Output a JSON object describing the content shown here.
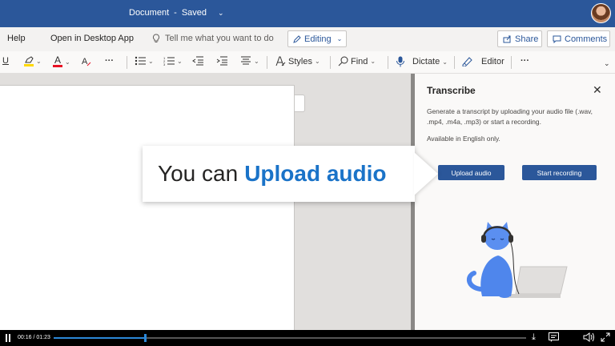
{
  "titlebar": {
    "doc_name": "Document",
    "separator": "-",
    "status": "Saved"
  },
  "menu": {
    "help": "Help",
    "open_desktop": "Open in Desktop App",
    "tell_me": "Tell me what you want to do",
    "editing": "Editing",
    "share": "Share",
    "comments": "Comments"
  },
  "ribbon": {
    "underline": "U",
    "font_color": "A",
    "more1": "···",
    "styles": "Styles",
    "find": "Find",
    "dictate": "Dictate",
    "editor": "Editor",
    "more2": "···",
    "highlight_color": "#ffd800",
    "font_color_bar": "#e81123"
  },
  "pane": {
    "title": "Transcribe",
    "description": "Generate a transcript by uploading your audio file (.wav, .mp4, .m4a, .mp3) or start a recording.",
    "availability": "Available in English only.",
    "upload_button": "Upload audio",
    "record_button": "Start recording"
  },
  "callout": {
    "lead": "You can",
    "highlight": "Upload audio"
  },
  "video": {
    "time": "00:16 / 01:23",
    "progress": 0.1928
  }
}
